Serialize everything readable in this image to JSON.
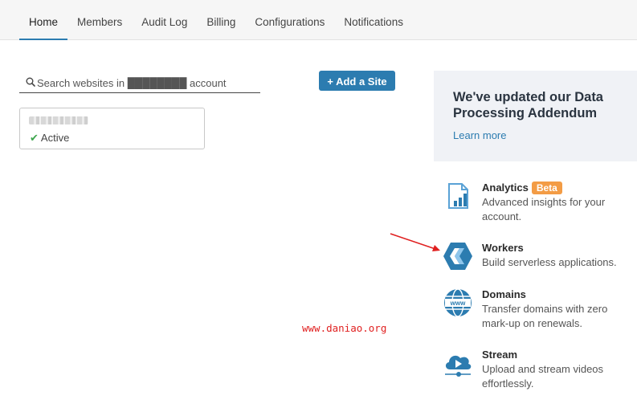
{
  "nav": {
    "tabs": [
      {
        "label": "Home",
        "active": true
      },
      {
        "label": "Members"
      },
      {
        "label": "Audit Log"
      },
      {
        "label": "Billing"
      },
      {
        "label": "Configurations"
      },
      {
        "label": "Notifications"
      }
    ]
  },
  "search": {
    "placeholder": "Search websites in ████████ account",
    "icon": "search-icon"
  },
  "add_site": {
    "label": "+ Add a Site"
  },
  "site": {
    "status": "Active",
    "status_color": "#3ea64e"
  },
  "banner": {
    "title": "We've updated our Data Processing Addendum",
    "link": "Learn more"
  },
  "products": {
    "analytics": {
      "name": "Analytics",
      "badge": "Beta",
      "desc": "Advanced insights for your account.",
      "icon": "analytics-icon"
    },
    "workers": {
      "name": "Workers",
      "desc": "Build serverless applications.",
      "icon": "workers-icon"
    },
    "domains": {
      "name": "Domains",
      "desc": "Transfer domains with zero mark-up on renewals.",
      "icon": "domains-www-icon"
    },
    "stream": {
      "name": "Stream",
      "desc": "Upload and stream videos effortlessly.",
      "icon": "stream-cloud-icon"
    }
  },
  "watermark": {
    "text": "www.daniao.org"
  },
  "colors": {
    "accent": "#2c7cb0",
    "badge": "#f39c45",
    "annotation": "#e02020"
  }
}
